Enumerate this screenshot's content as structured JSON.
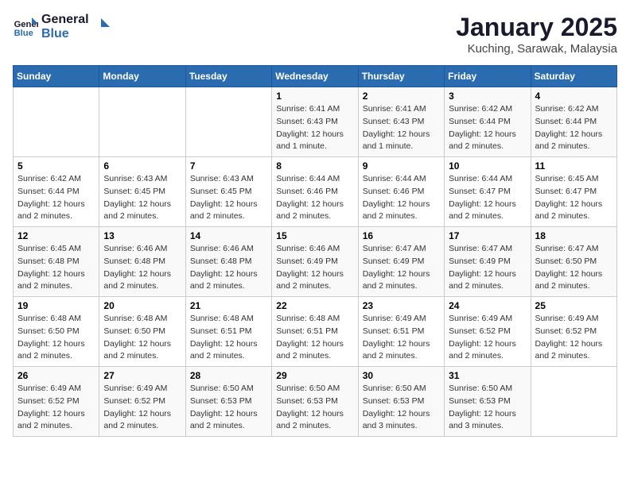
{
  "header": {
    "logo_line1": "General",
    "logo_line2": "Blue",
    "title": "January 2025",
    "subtitle": "Kuching, Sarawak, Malaysia"
  },
  "weekdays": [
    "Sunday",
    "Monday",
    "Tuesday",
    "Wednesday",
    "Thursday",
    "Friday",
    "Saturday"
  ],
  "weeks": [
    [
      {
        "day": "",
        "info": ""
      },
      {
        "day": "",
        "info": ""
      },
      {
        "day": "",
        "info": ""
      },
      {
        "day": "1",
        "info": "Sunrise: 6:41 AM\nSunset: 6:43 PM\nDaylight: 12 hours\nand 1 minute."
      },
      {
        "day": "2",
        "info": "Sunrise: 6:41 AM\nSunset: 6:43 PM\nDaylight: 12 hours\nand 1 minute."
      },
      {
        "day": "3",
        "info": "Sunrise: 6:42 AM\nSunset: 6:44 PM\nDaylight: 12 hours\nand 2 minutes."
      },
      {
        "day": "4",
        "info": "Sunrise: 6:42 AM\nSunset: 6:44 PM\nDaylight: 12 hours\nand 2 minutes."
      }
    ],
    [
      {
        "day": "5",
        "info": "Sunrise: 6:42 AM\nSunset: 6:44 PM\nDaylight: 12 hours\nand 2 minutes."
      },
      {
        "day": "6",
        "info": "Sunrise: 6:43 AM\nSunset: 6:45 PM\nDaylight: 12 hours\nand 2 minutes."
      },
      {
        "day": "7",
        "info": "Sunrise: 6:43 AM\nSunset: 6:45 PM\nDaylight: 12 hours\nand 2 minutes."
      },
      {
        "day": "8",
        "info": "Sunrise: 6:44 AM\nSunset: 6:46 PM\nDaylight: 12 hours\nand 2 minutes."
      },
      {
        "day": "9",
        "info": "Sunrise: 6:44 AM\nSunset: 6:46 PM\nDaylight: 12 hours\nand 2 minutes."
      },
      {
        "day": "10",
        "info": "Sunrise: 6:44 AM\nSunset: 6:47 PM\nDaylight: 12 hours\nand 2 minutes."
      },
      {
        "day": "11",
        "info": "Sunrise: 6:45 AM\nSunset: 6:47 PM\nDaylight: 12 hours\nand 2 minutes."
      }
    ],
    [
      {
        "day": "12",
        "info": "Sunrise: 6:45 AM\nSunset: 6:48 PM\nDaylight: 12 hours\nand 2 minutes."
      },
      {
        "day": "13",
        "info": "Sunrise: 6:46 AM\nSunset: 6:48 PM\nDaylight: 12 hours\nand 2 minutes."
      },
      {
        "day": "14",
        "info": "Sunrise: 6:46 AM\nSunset: 6:48 PM\nDaylight: 12 hours\nand 2 minutes."
      },
      {
        "day": "15",
        "info": "Sunrise: 6:46 AM\nSunset: 6:49 PM\nDaylight: 12 hours\nand 2 minutes."
      },
      {
        "day": "16",
        "info": "Sunrise: 6:47 AM\nSunset: 6:49 PM\nDaylight: 12 hours\nand 2 minutes."
      },
      {
        "day": "17",
        "info": "Sunrise: 6:47 AM\nSunset: 6:49 PM\nDaylight: 12 hours\nand 2 minutes."
      },
      {
        "day": "18",
        "info": "Sunrise: 6:47 AM\nSunset: 6:50 PM\nDaylight: 12 hours\nand 2 minutes."
      }
    ],
    [
      {
        "day": "19",
        "info": "Sunrise: 6:48 AM\nSunset: 6:50 PM\nDaylight: 12 hours\nand 2 minutes."
      },
      {
        "day": "20",
        "info": "Sunrise: 6:48 AM\nSunset: 6:50 PM\nDaylight: 12 hours\nand 2 minutes."
      },
      {
        "day": "21",
        "info": "Sunrise: 6:48 AM\nSunset: 6:51 PM\nDaylight: 12 hours\nand 2 minutes."
      },
      {
        "day": "22",
        "info": "Sunrise: 6:48 AM\nSunset: 6:51 PM\nDaylight: 12 hours\nand 2 minutes."
      },
      {
        "day": "23",
        "info": "Sunrise: 6:49 AM\nSunset: 6:51 PM\nDaylight: 12 hours\nand 2 minutes."
      },
      {
        "day": "24",
        "info": "Sunrise: 6:49 AM\nSunset: 6:52 PM\nDaylight: 12 hours\nand 2 minutes."
      },
      {
        "day": "25",
        "info": "Sunrise: 6:49 AM\nSunset: 6:52 PM\nDaylight: 12 hours\nand 2 minutes."
      }
    ],
    [
      {
        "day": "26",
        "info": "Sunrise: 6:49 AM\nSunset: 6:52 PM\nDaylight: 12 hours\nand 2 minutes."
      },
      {
        "day": "27",
        "info": "Sunrise: 6:49 AM\nSunset: 6:52 PM\nDaylight: 12 hours\nand 2 minutes."
      },
      {
        "day": "28",
        "info": "Sunrise: 6:50 AM\nSunset: 6:53 PM\nDaylight: 12 hours\nand 2 minutes."
      },
      {
        "day": "29",
        "info": "Sunrise: 6:50 AM\nSunset: 6:53 PM\nDaylight: 12 hours\nand 2 minutes."
      },
      {
        "day": "30",
        "info": "Sunrise: 6:50 AM\nSunset: 6:53 PM\nDaylight: 12 hours\nand 3 minutes."
      },
      {
        "day": "31",
        "info": "Sunrise: 6:50 AM\nSunset: 6:53 PM\nDaylight: 12 hours\nand 3 minutes."
      },
      {
        "day": "",
        "info": ""
      }
    ]
  ]
}
